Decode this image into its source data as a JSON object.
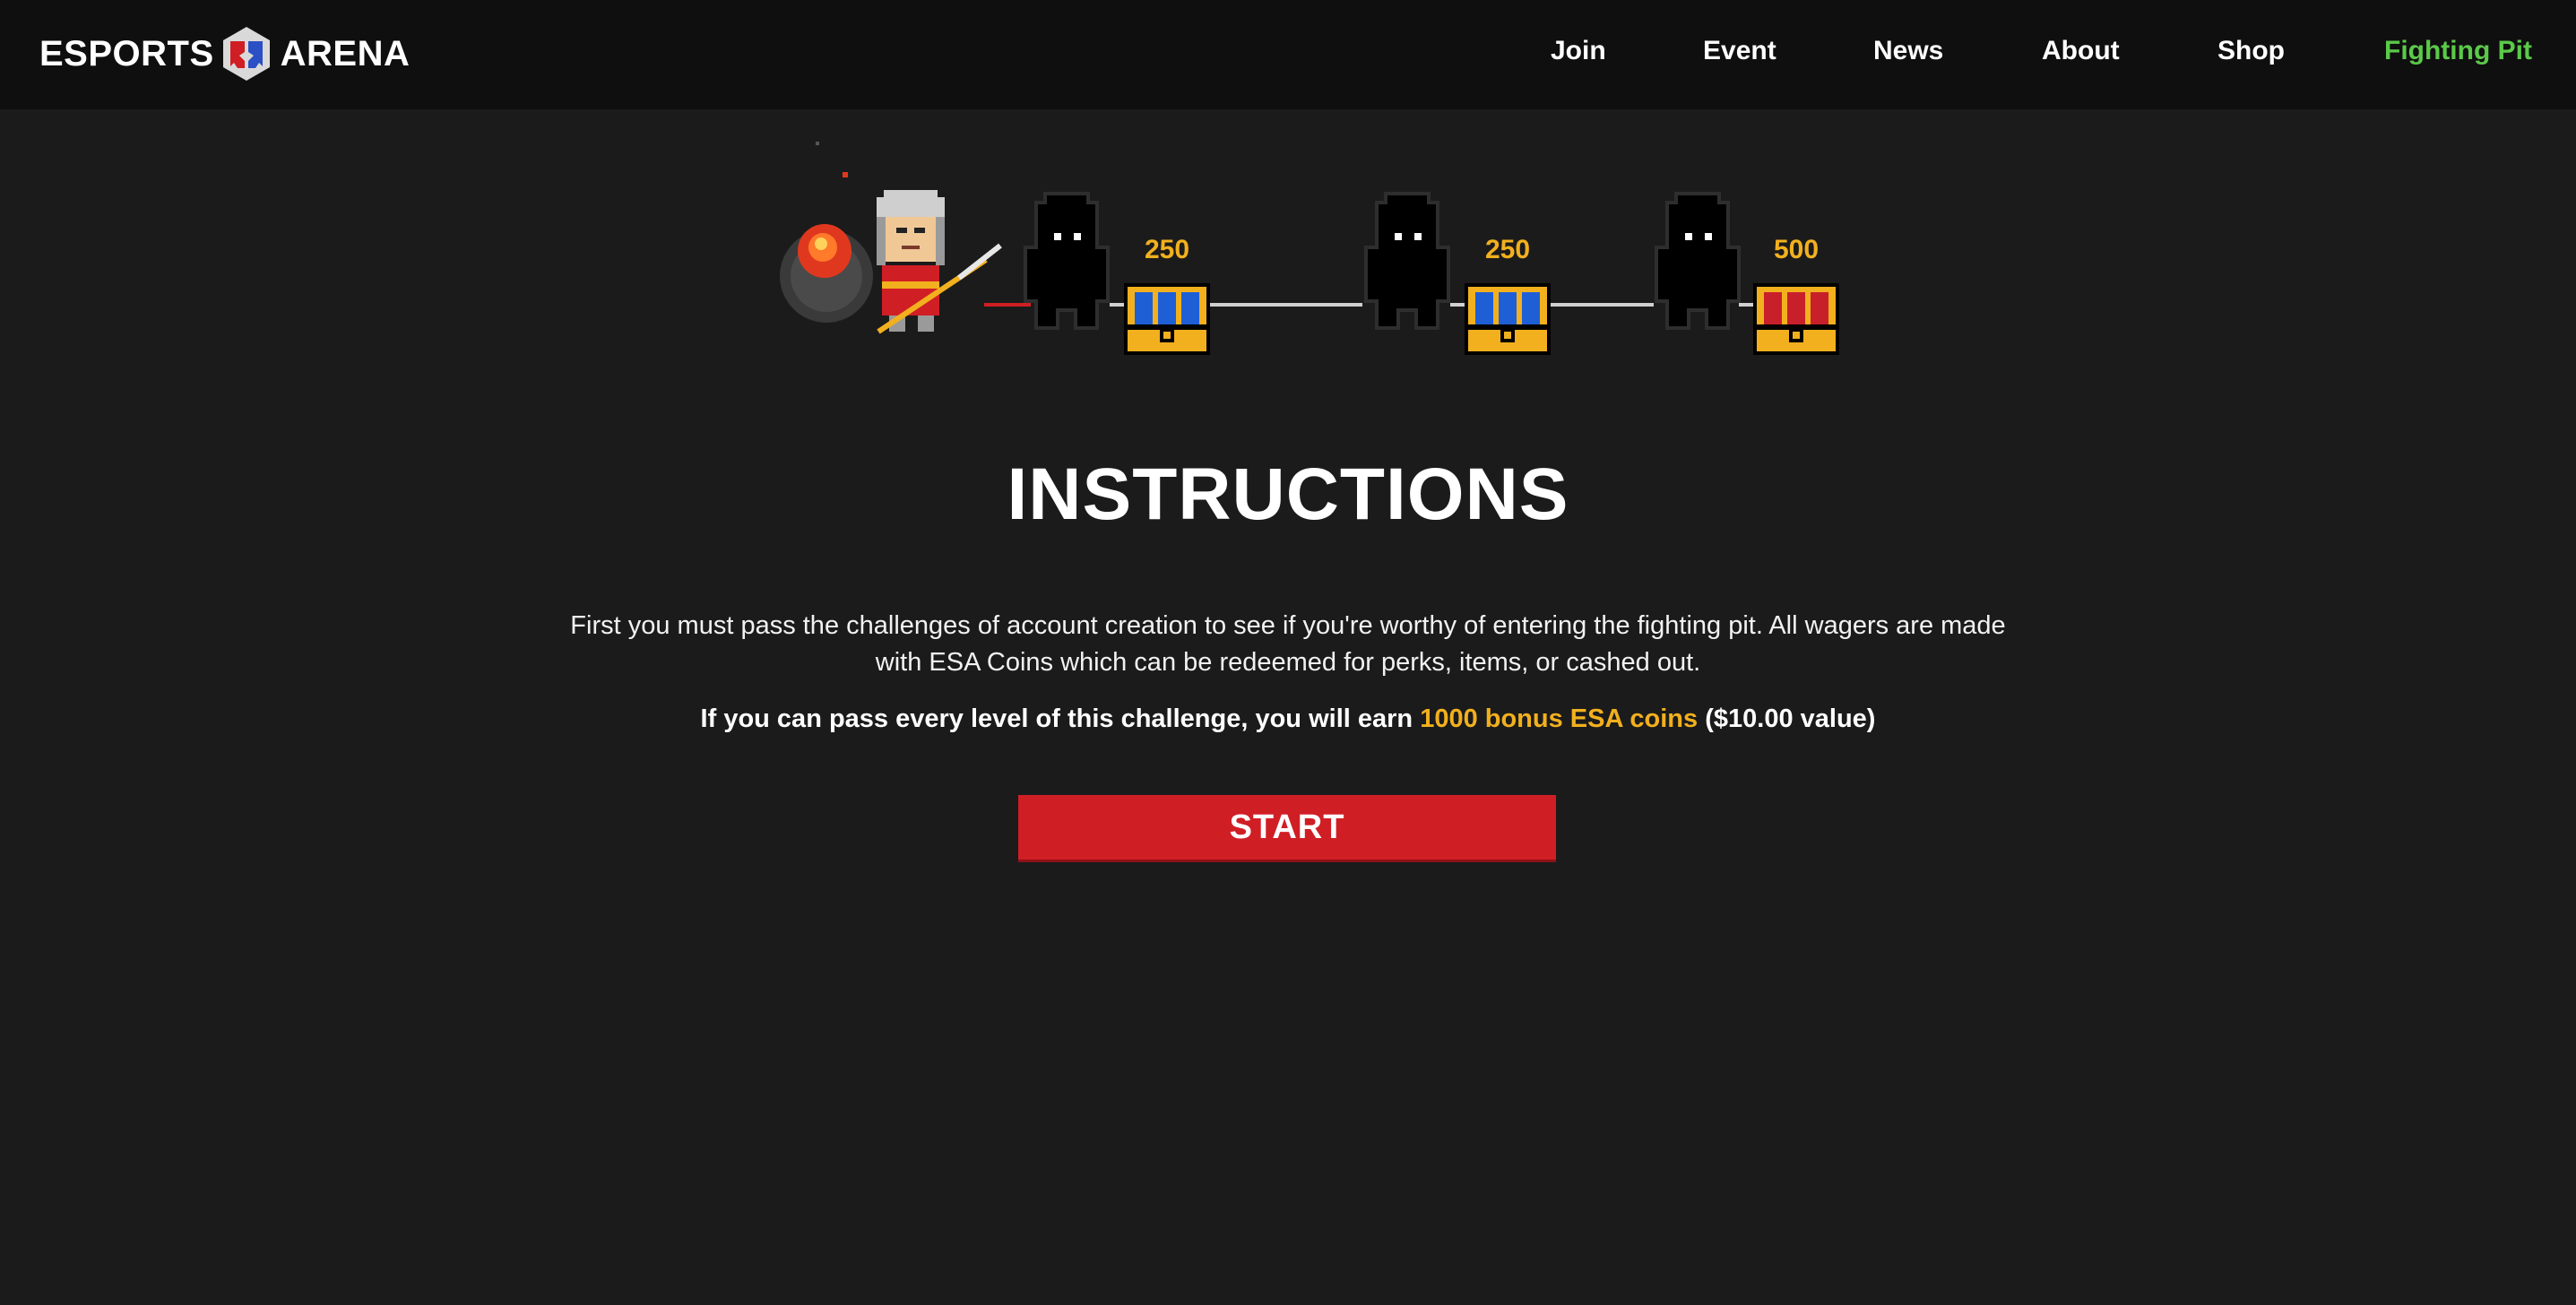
{
  "header": {
    "logo_left": "ESPORTS",
    "logo_right": "ARENA",
    "nav": [
      {
        "label": "Join"
      },
      {
        "label": "Event"
      },
      {
        "label": "News"
      },
      {
        "label": "About"
      },
      {
        "label": "Shop"
      },
      {
        "label": "Fighting Pit"
      }
    ],
    "active_nav": "Fighting Pit",
    "active_color": "#5bc94a"
  },
  "progress": {
    "rewards": [
      {
        "amount": "250",
        "chest": "blue"
      },
      {
        "amount": "250",
        "chest": "blue"
      },
      {
        "amount": "500",
        "chest": "red"
      }
    ],
    "reward_color": "#f2b01e"
  },
  "main": {
    "title": "INSTRUCTIONS",
    "paragraph": "First you must pass the challenges of account creation to see if you're worthy of entering the fighting pit. All wagers are made with ESA Coins which can be redeemed for perks, items, or cashed out.",
    "bonus_prefix": "If you can pass every level of this challenge, you will earn ",
    "bonus_highlight": "1000 bonus ESA coins",
    "bonus_suffix": " ($10.00 value)",
    "start_label": "START"
  },
  "colors": {
    "background": "#1b1b1b",
    "topbar": "#0f0f0f",
    "accent_red": "#d01e25",
    "highlight_gold": "#f2b01e"
  }
}
